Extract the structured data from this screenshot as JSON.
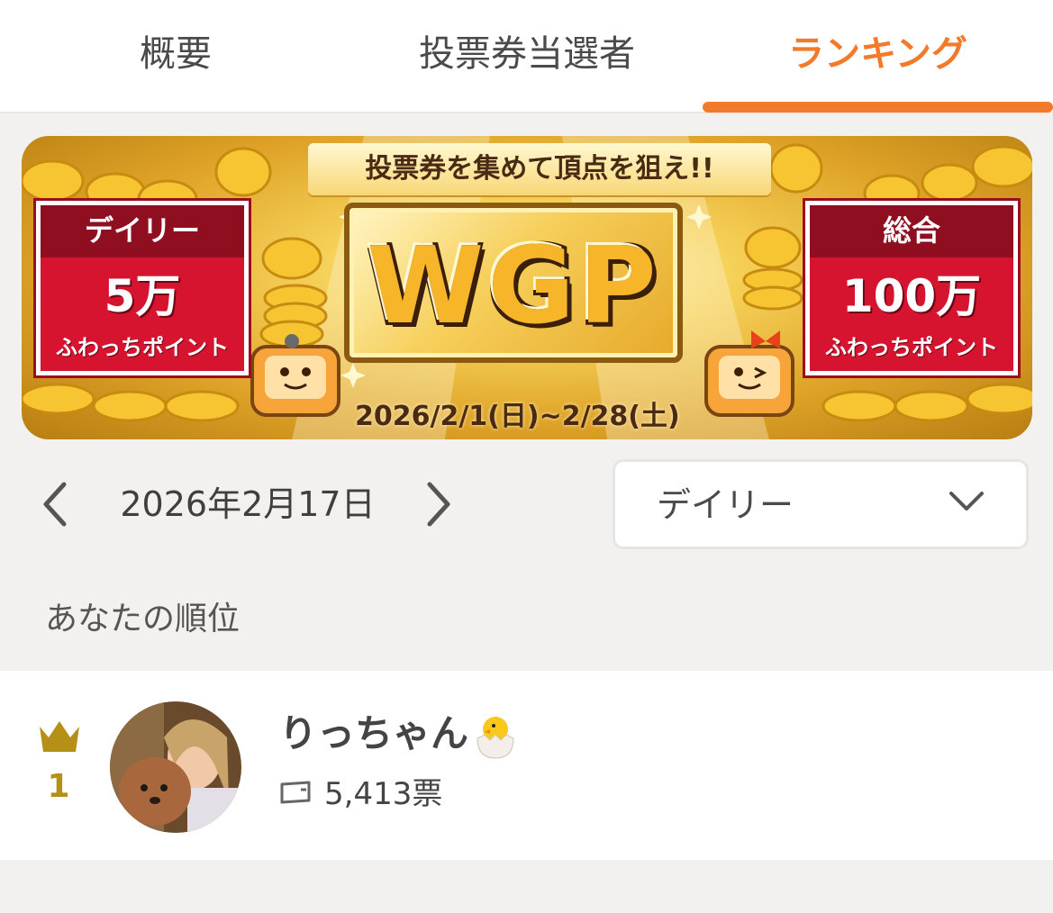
{
  "tabs": [
    {
      "label": "概要",
      "active": false
    },
    {
      "label": "投票券当選者",
      "active": false
    },
    {
      "label": "ランキング",
      "active": true
    }
  ],
  "colors": {
    "accent": "#f47a2b",
    "prize_red": "#d6142f",
    "gold_rank": "#b58f16"
  },
  "banner": {
    "ribbon": "投票券を集めて頂点を狙え!!",
    "logo": "WGP",
    "left_prize": {
      "label": "デイリー",
      "amount": "5万",
      "unit": "ふわっちポイント"
    },
    "right_prize": {
      "label": "総合",
      "amount": "100万",
      "unit": "ふわっちポイント"
    },
    "period": "2026/2/1(日)~2/28(土)"
  },
  "date_nav": {
    "date": "2026年2月17日",
    "prev_icon": "chevron-left-icon",
    "next_icon": "chevron-right-icon"
  },
  "period_select": {
    "value": "デイリー"
  },
  "your_rank": {
    "title": "あなたの順位",
    "rank": "1",
    "name": "りっちゃん",
    "votes": "5,413票"
  }
}
